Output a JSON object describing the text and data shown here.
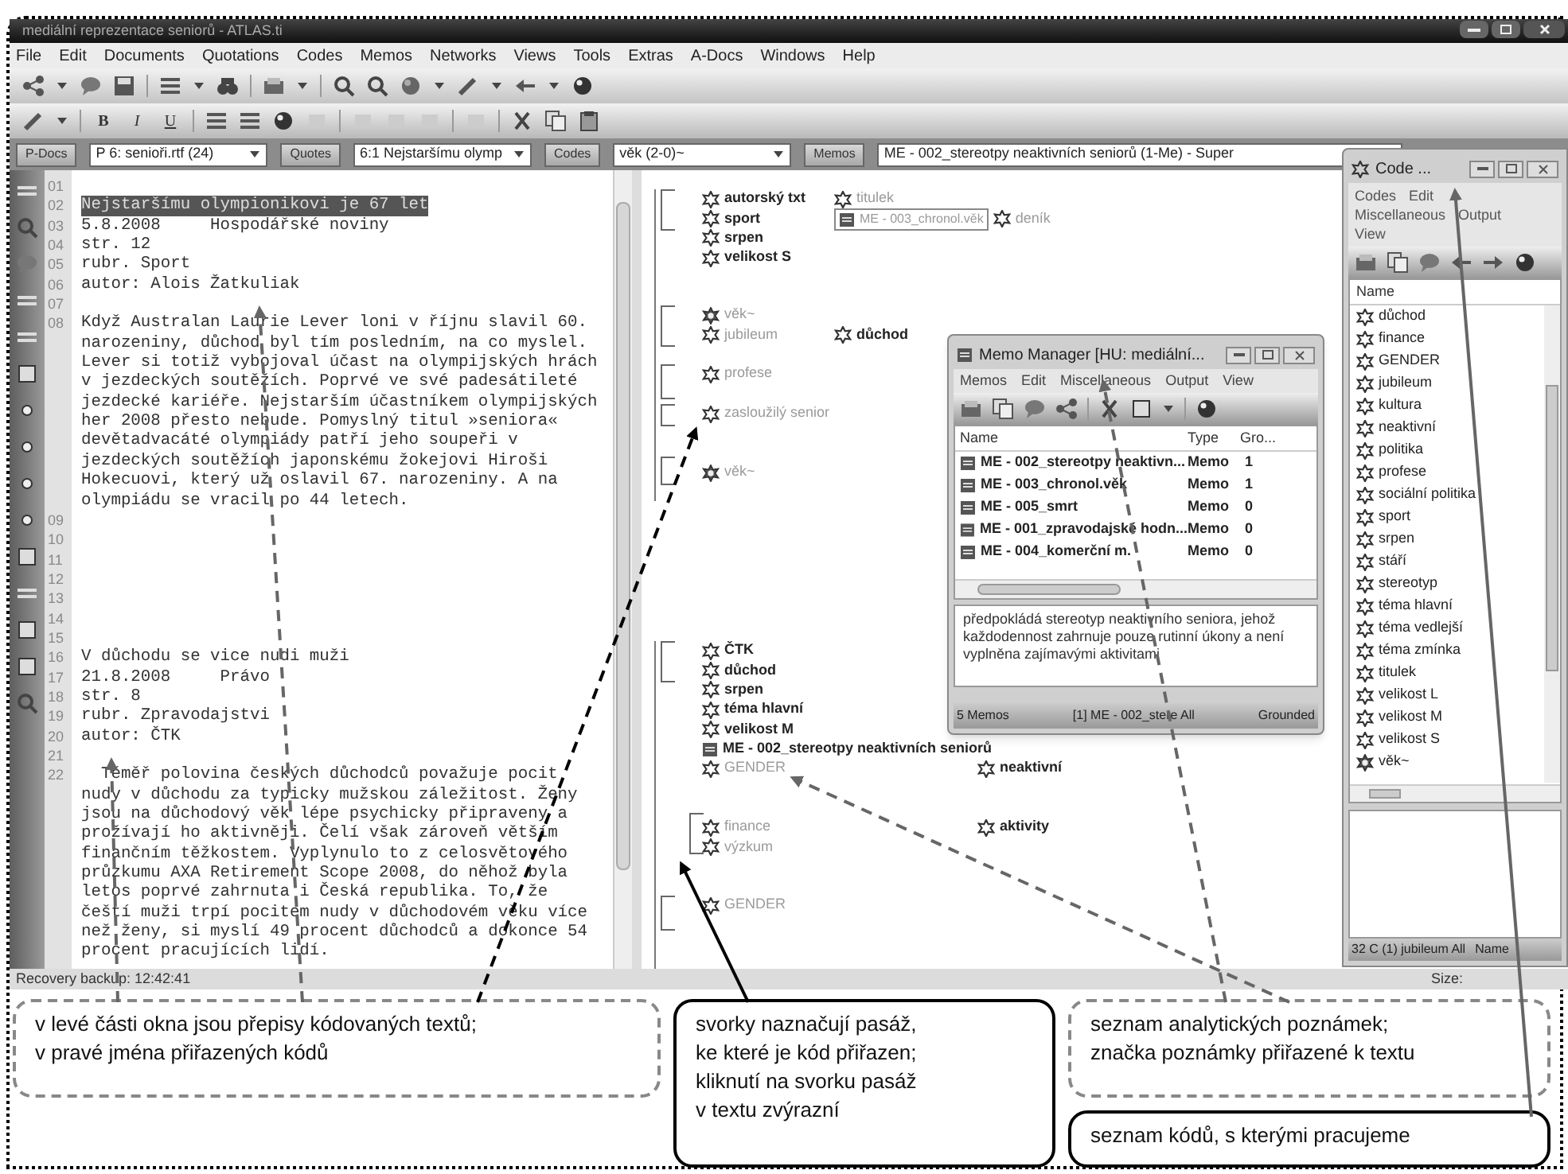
{
  "window": {
    "title": "mediální reprezentace seniorů - ATLAS.ti"
  },
  "menu": [
    "File",
    "Edit",
    "Documents",
    "Quotations",
    "Codes",
    "Memos",
    "Networks",
    "Views",
    "Tools",
    "Extras",
    "A-Docs",
    "Windows",
    "Help"
  ],
  "format_buttons": [
    "B",
    "I",
    "U"
  ],
  "selectors": [
    {
      "button": "P-Docs",
      "value": "P 6: senioři.rtf (24)",
      "kind": "dropdown"
    },
    {
      "button": "Quotes",
      "value": "6:1 Nejstaršímu olymp",
      "kind": "dropdown"
    },
    {
      "button": "Codes",
      "value": "věk (2-0)~",
      "kind": "dropdown"
    },
    {
      "button": "Memos",
      "value": "ME - 002_stereotpy neaktivních seniorů (1-Me) - Super",
      "kind": "field"
    }
  ],
  "document": {
    "paragraphs": [
      {
        "number": "01",
        "selected": false
      },
      {
        "number": "02",
        "lines": [
          "Nejstaršímu olympionikovi je 67 let"
        ],
        "selected": true
      },
      {
        "number": "03",
        "lines": [
          "5.8.2008     Hospodářské noviny"
        ],
        "selected": false
      },
      {
        "number": "04",
        "lines": [
          "str. 12"
        ],
        "selected": false
      },
      {
        "number": "05",
        "lines": [
          "rubr. Sport"
        ],
        "selected": false
      },
      {
        "number": "06",
        "lines": [
          "autor: Alois Žatkuliak"
        ],
        "selected": false
      },
      {
        "number": "07",
        "selected": false
      },
      {
        "number": "08",
        "lines": [
          "Když Australan Laurie Lever loni v říjnu slavil 60.",
          "narozeniny, důchod byl tím posledním, na co myslel.",
          "Lever si totiž vybojoval účast na olympijských hrách",
          "v jezdeckých soutěžích. Poprvé ve své padesátileté",
          "jezdecké kariéře. Nejstarším účastníkem olympijských",
          "her 2008 přesto nebude. Pomyslný titul »seniora«",
          "devětadvacáté olympiády patří jeho soupeři v",
          "jezdeckých soutěžích japonskému žokejovi Hiroši",
          "Hokecuovi, který už oslavil 67. narozeniny. A na",
          "olympiádu se vracil po 44 letech."
        ],
        "selected": false
      },
      {
        "number": "09",
        "selected": false
      },
      {
        "number": "10",
        "selected": false
      },
      {
        "number": "11",
        "selected": false
      },
      {
        "number": "12",
        "selected": false
      },
      {
        "number": "13",
        "selected": false
      },
      {
        "number": "14",
        "selected": false
      },
      {
        "number": "15",
        "selected": false
      },
      {
        "number": "16",
        "lines": [
          "V důchodu se vice nudi muži"
        ],
        "selected": false
      },
      {
        "number": "17",
        "lines": [
          "21.8.2008     Právo"
        ],
        "selected": false
      },
      {
        "number": "18",
        "lines": [
          "str. 8"
        ],
        "selected": false
      },
      {
        "number": "19",
        "lines": [
          "rubr. Zpravodajstvi"
        ],
        "selected": false
      },
      {
        "number": "20",
        "lines": [
          "autor: ČTK"
        ],
        "selected": false
      },
      {
        "number": "21",
        "selected": false
      },
      {
        "number": "22",
        "lines": [
          "  Téměř polovina českých důchodců považuje pocit",
          "nudy v důchodu za typicky mužskou záležitost. Ženy",
          "jsou na důchodový věk lépe psychicky připraveny a",
          "prožívají ho aktivněji. Čelí však zároveň větším",
          "finančním těžkostem. Vyplynulo to z celosvětového",
          "průzkumu AXA Retirement Scope 2008, do něhož byla",
          "letos poprvé zahrnuta i Česká republika. To, že",
          "čeští muži trpí pocitem nudy v důchodovém věku více",
          "než ženy, si myslí 49 procent důchodců a dokonce 54",
          "procent pracujících lidí."
        ],
        "selected": false
      }
    ]
  },
  "margin": [
    {
      "rows": [
        [
          {
            "label": "autorský txt",
            "kind": "code",
            "muted": false
          },
          {
            "label": "titulek",
            "kind": "code",
            "muted": true
          }
        ],
        [
          {
            "label": "sport",
            "kind": "code",
            "muted": false
          },
          {
            "label": "ME - 003_chronol.věk",
            "kind": "memo",
            "muted": true
          },
          {
            "label": "deník",
            "kind": "code",
            "muted": true
          }
        ],
        [
          {
            "label": "srpen",
            "kind": "code",
            "muted": false
          }
        ],
        [
          {
            "label": "velikost S",
            "kind": "code",
            "muted": false
          }
        ]
      ]
    },
    {
      "rows": [
        [
          {
            "label": "věk~",
            "kind": "family",
            "muted": true
          }
        ],
        [
          {
            "label": "jubileum",
            "kind": "code",
            "muted": true
          },
          {
            "label": "důchod",
            "kind": "code",
            "muted": false
          }
        ]
      ]
    },
    {
      "rows": [
        [
          {
            "label": "profese",
            "kind": "code",
            "muted": true
          }
        ]
      ]
    },
    {
      "rows": [
        [
          {
            "label": "zasloužilý senior",
            "kind": "code",
            "muted": true
          }
        ]
      ]
    },
    {
      "rows": [
        [
          {
            "label": "věk~",
            "kind": "family",
            "muted": true
          }
        ]
      ]
    },
    {
      "rows": [
        [
          {
            "label": "ČTK",
            "kind": "code",
            "muted": false
          }
        ],
        [
          {
            "label": "důchod",
            "kind": "code",
            "muted": false
          }
        ],
        [
          {
            "label": "srpen",
            "kind": "code",
            "muted": false
          }
        ],
        [
          {
            "label": "téma hlavní",
            "kind": "code",
            "muted": false
          }
        ],
        [
          {
            "label": "velikost M",
            "kind": "code",
            "muted": false
          }
        ],
        [
          {
            "label": "ME - 002_stereotpy neaktivních seniorů",
            "kind": "memo",
            "muted": false
          }
        ],
        [
          {
            "label": "GENDER",
            "kind": "code",
            "muted": true
          },
          {
            "label": "neaktivní",
            "kind": "code",
            "muted": false
          }
        ]
      ]
    },
    {
      "rows": [
        [
          {
            "label": "finance",
            "kind": "code",
            "muted": true
          },
          {
            "label": "aktivity",
            "kind": "code",
            "muted": false
          }
        ],
        [
          {
            "label": "výzkum",
            "kind": "code",
            "muted": true
          }
        ]
      ]
    },
    {
      "rows": [
        [
          {
            "label": "GENDER",
            "kind": "code",
            "muted": true
          }
        ]
      ]
    }
  ],
  "memo_manager": {
    "title": "Memo Manager [HU: mediální...",
    "menu": [
      "Memos",
      "Edit",
      "Miscellaneous",
      "Output",
      "View"
    ],
    "columns": [
      "Name",
      "Type",
      "Gro..."
    ],
    "rows": [
      {
        "name": "ME - 002_stereotpy neaktivn...",
        "type": "Memo",
        "grounded": "1"
      },
      {
        "name": "ME - 003_chronol.věk",
        "type": "Memo",
        "grounded": "1"
      },
      {
        "name": "ME - 005_smrt",
        "type": "Memo",
        "grounded": "0"
      },
      {
        "name": "ME - 001_zpravodajské hodn...",
        "type": "Memo",
        "grounded": "0"
      },
      {
        "name": "ME - 004_komerční m.",
        "type": "Memo",
        "grounded": "0"
      }
    ],
    "preview": "předpokládá stereotyp neaktivního seniora, jehož každodennost zahrnuje pouze rutinní úkony a není vyplněna zajímavými aktivitami",
    "status": [
      "5 Memos",
      "[1] ME - 002_stere All",
      "Grounded"
    ]
  },
  "code_manager": {
    "title": "Code ...",
    "menu_rows": [
      [
        "Codes",
        "Edit"
      ],
      [
        "Miscellaneous",
        "Output"
      ],
      [
        "View"
      ]
    ],
    "column": "Name",
    "items": [
      {
        "label": "důchod",
        "kind": "code"
      },
      {
        "label": "finance",
        "kind": "code"
      },
      {
        "label": "GENDER",
        "kind": "code"
      },
      {
        "label": "jubileum",
        "kind": "code"
      },
      {
        "label": "kultura",
        "kind": "code"
      },
      {
        "label": "neaktivní",
        "kind": "code"
      },
      {
        "label": "politika",
        "kind": "code"
      },
      {
        "label": "profese",
        "kind": "code"
      },
      {
        "label": "sociální politika",
        "kind": "code"
      },
      {
        "label": "sport",
        "kind": "code"
      },
      {
        "label": "srpen",
        "kind": "code"
      },
      {
        "label": "stáří",
        "kind": "code"
      },
      {
        "label": "stereotyp",
        "kind": "code"
      },
      {
        "label": "téma hlavní",
        "kind": "code"
      },
      {
        "label": "téma vedlejší",
        "kind": "code"
      },
      {
        "label": "téma zmínka",
        "kind": "code"
      },
      {
        "label": "titulek",
        "kind": "code"
      },
      {
        "label": "velikost L",
        "kind": "code"
      },
      {
        "label": "velikost M",
        "kind": "code"
      },
      {
        "label": "velikost S",
        "kind": "code"
      },
      {
        "label": "věk~",
        "kind": "family"
      }
    ],
    "status": [
      "32 C (1) jubileum All",
      "Name"
    ]
  },
  "status_bar": {
    "left": "Recovery backup: 12:42:41",
    "right": "Size:"
  },
  "annotations": [
    {
      "kind": "dashed",
      "lines": [
        "v levé části okna jsou přepisy kódovaných textů;",
        "v pravé jména přiřazených kódů"
      ]
    },
    {
      "kind": "solid",
      "lines": [
        "svorky naznačují pasáž,",
        "ke které je kód přiřazen;",
        "kliknutí na svorku pasáž",
        "v textu zvýrazní"
      ]
    },
    {
      "kind": "dashed",
      "lines": [
        "seznam analytických poznámek;",
        "značka poznámky přiřazené k textu"
      ]
    },
    {
      "kind": "solid",
      "lines": [
        "seznam kódů, s kterými pracujeme"
      ]
    }
  ]
}
